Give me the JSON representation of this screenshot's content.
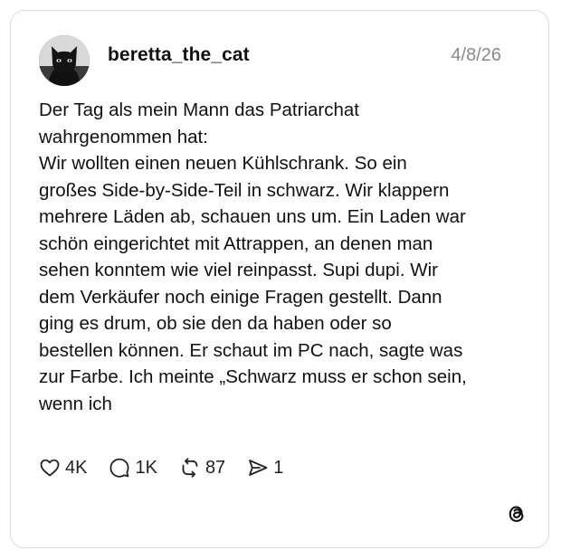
{
  "post": {
    "username": "beretta_the_cat",
    "date": "4/8/26",
    "avatar_icon": "black-cat-avatar",
    "lines": [
      "Der Tag als mein Mann das Patriarchat",
      "wahrgenommen hat:",
      "Wir wollten einen neuen Kühlschrank. So ein",
      "großes Side-by-Side-Teil in schwarz. Wir klappern",
      "mehrere Läden ab, schauen uns um. Ein Laden war",
      "schön eingerichtet mit Attrappen, an denen man",
      "sehen konntem wie viel reinpasst. Supi dupi. Wir",
      "dem Verkäufer noch einige Fragen gestellt. Dann",
      "ging es drum, ob sie den da haben oder so",
      "bestellen können. Er schaut im PC nach, sagte was",
      "zur Farbe. Ich meinte „Schwarz muss er schon sein,",
      "wenn ich"
    ]
  },
  "actions": {
    "likes": "4K",
    "replies": "1K",
    "reposts": "87",
    "shares": "1"
  },
  "icons": {
    "like": "heart-icon",
    "reply": "speech-bubble-icon",
    "repost": "repost-icon",
    "share": "send-icon",
    "brand": "threads-logo-icon"
  }
}
